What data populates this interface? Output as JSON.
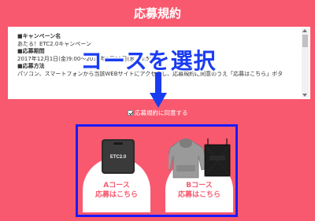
{
  "header": {
    "title": "応募規約"
  },
  "terms": {
    "lines": [
      {
        "text": "■キャンペーン名",
        "bold": true
      },
      {
        "text": "あたる！ETC2.0キャンペーン",
        "bold": false
      },
      {
        "text": "■応募期間",
        "bold": true
      },
      {
        "text": "2017年12月1日(金)9:00〜2018年1月31日(水)23:59",
        "bold": false
      },
      {
        "text": "■応募方法",
        "bold": true
      },
      {
        "text": "パソコン、スマートフォンから当該WEBサイトにアクセスし、応募規約に同意のうえ「応募はこちら」ボタ",
        "bold": false
      }
    ]
  },
  "annotation": {
    "title": "コースを選択"
  },
  "agreement": {
    "label": "応募規約に同意する",
    "checked": true
  },
  "courses": [
    {
      "name": "Aコース",
      "action": "応募はこちら",
      "product_label": "ETC2.0"
    },
    {
      "name": "Bコース",
      "action": "応募はこちら"
    }
  ],
  "colors": {
    "background": "#f9596f",
    "frame": "#1a1aff",
    "annotation": "#1a3cf0"
  }
}
